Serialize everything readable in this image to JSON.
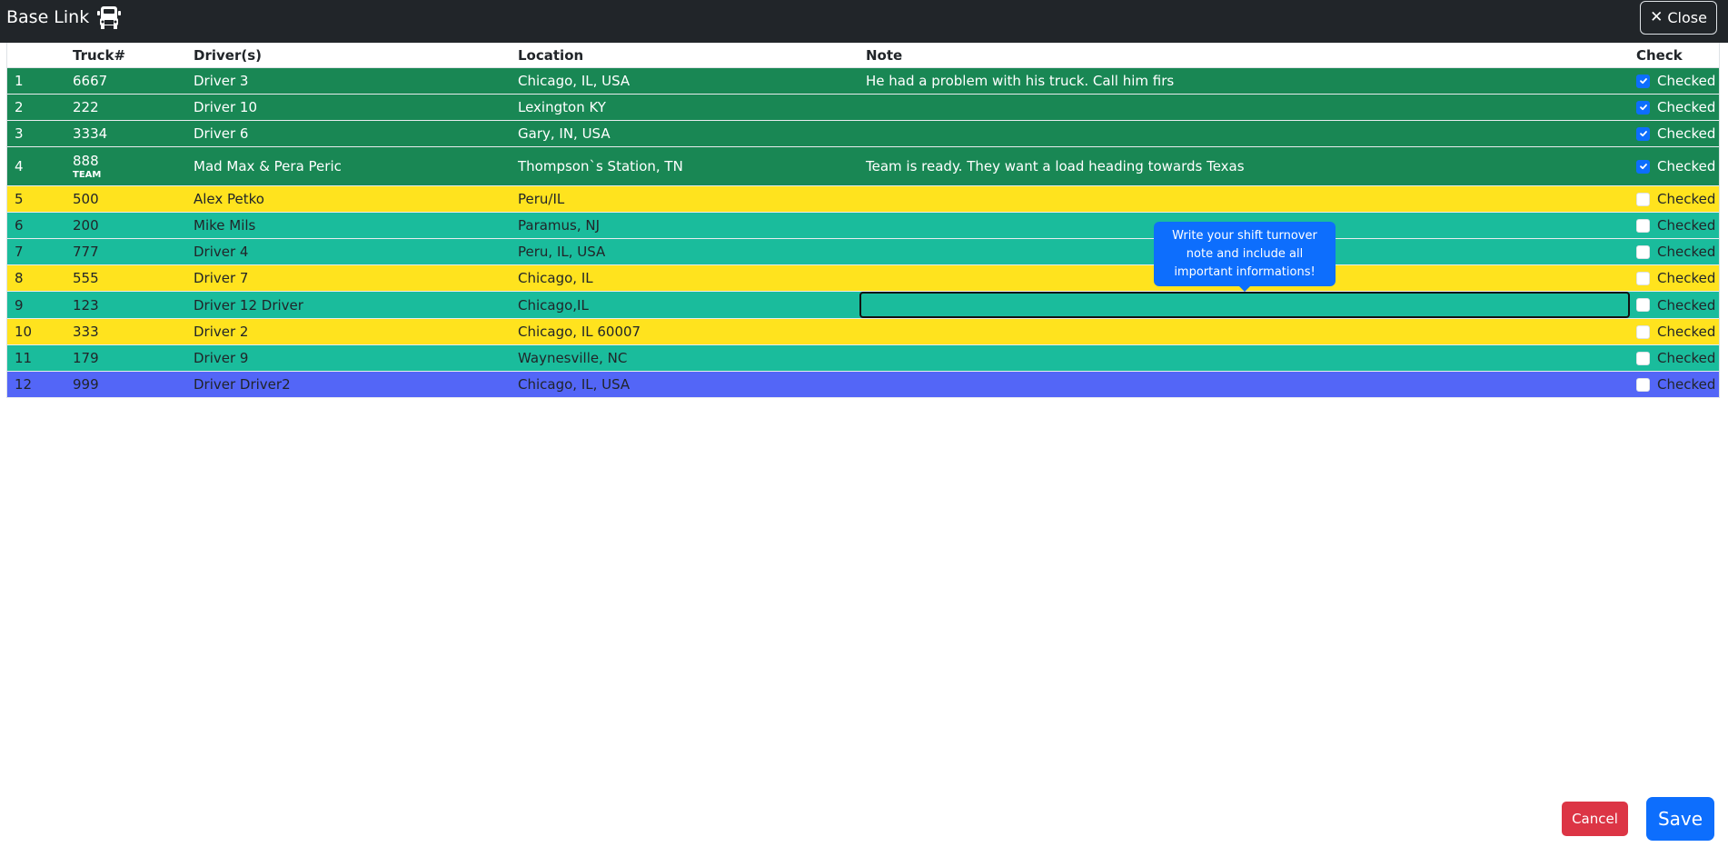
{
  "header": {
    "title": "Base Link",
    "logo_icon": "truck-icon",
    "close_label": "Close",
    "close_icon": "close-icon"
  },
  "table": {
    "columns": [
      "",
      "Truck#",
      "Driver(s)",
      "Location",
      "Note",
      "Check"
    ],
    "check_label": "Checked",
    "rows": [
      {
        "num": "1",
        "truck": "6667",
        "tag": "",
        "driver": "Driver 3",
        "location": "Chicago, IL, USA",
        "note": "He had a problem with his truck. Call him firs",
        "checked": true,
        "color": "green"
      },
      {
        "num": "2",
        "truck": "222",
        "tag": "",
        "driver": "Driver 10",
        "location": "Lexington KY",
        "note": "",
        "checked": true,
        "color": "green"
      },
      {
        "num": "3",
        "truck": "3334",
        "tag": "",
        "driver": "Driver 6",
        "location": "Gary, IN, USA",
        "note": "",
        "checked": true,
        "color": "green"
      },
      {
        "num": "4",
        "truck": "888",
        "tag": "TEAM",
        "driver": "Mad Max & Pera Peric",
        "location": "Thompson`s Station, TN",
        "note": "Team is ready. They want a load heading towards Texas",
        "checked": true,
        "color": "green"
      },
      {
        "num": "5",
        "truck": "500",
        "tag": "",
        "driver": "Alex Petko",
        "location": "Peru/IL",
        "note": "",
        "checked": false,
        "color": "yellow"
      },
      {
        "num": "6",
        "truck": "200",
        "tag": "",
        "driver": "Mike Mils",
        "location": "Paramus, NJ",
        "note": "",
        "checked": false,
        "color": "teal"
      },
      {
        "num": "7",
        "truck": "777",
        "tag": "",
        "driver": "Driver 4",
        "location": "Peru, IL, USA",
        "note": "",
        "checked": false,
        "color": "teal"
      },
      {
        "num": "8",
        "truck": "555",
        "tag": "",
        "driver": "Driver 7",
        "location": "Chicago, IL",
        "note": "",
        "checked": false,
        "color": "yellow"
      },
      {
        "num": "9",
        "truck": "123",
        "tag": "",
        "driver": "Driver 12 Driver",
        "location": "Chicago,IL",
        "note": "",
        "checked": false,
        "color": "teal",
        "editing": true
      },
      {
        "num": "10",
        "truck": "333",
        "tag": "",
        "driver": "Driver 2",
        "location": "Chicago, IL 60007",
        "note": "",
        "checked": false,
        "color": "yellow"
      },
      {
        "num": "11",
        "truck": "179",
        "tag": "",
        "driver": "Driver 9",
        "location": "Waynesville, NC",
        "note": "",
        "checked": false,
        "color": "teal"
      },
      {
        "num": "12",
        "truck": "999",
        "tag": "",
        "driver": "Driver Driver2",
        "location": "Chicago, IL, USA",
        "note": "",
        "checked": false,
        "color": "blue"
      }
    ]
  },
  "tooltip": {
    "text": "Write your shift turnover note and include all important informations!"
  },
  "footer": {
    "cancel_label": "Cancel",
    "save_label": "Save"
  },
  "colors": {
    "green": "#198754",
    "yellow": "#ffe31e",
    "teal": "#1abc9c",
    "blue": "#5366f7",
    "primary": "#0d6efd",
    "danger": "#dc3545",
    "topbar": "#212529"
  }
}
